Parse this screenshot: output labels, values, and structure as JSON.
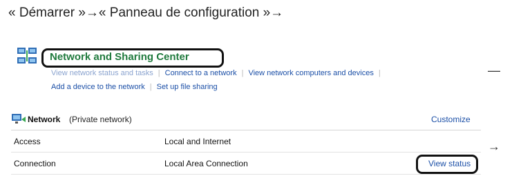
{
  "breadcrumb": {
    "text": "« Démarrer »→« Panneau de configuration »→"
  },
  "header": {
    "title": "Network and Sharing Center",
    "icon": "network-sharing-center-icon"
  },
  "links_row1": [
    "View network status and tasks",
    "Connect to a network",
    "View network computers and devices"
  ],
  "links_row2": [
    "Add a device to the network",
    "Set up file sharing"
  ],
  "trailing_dash": "—",
  "network": {
    "name": "Network",
    "type": "(Private network)",
    "customize": "Customize",
    "rows": [
      {
        "label": "Access",
        "value": "Local and Internet"
      },
      {
        "label": "Connection",
        "value": "Local Area Connection",
        "action": "View status"
      }
    ]
  },
  "right_arrow": "→",
  "colors": {
    "title_green": "#1f7a3d",
    "link_blue": "#1a4ea6"
  }
}
